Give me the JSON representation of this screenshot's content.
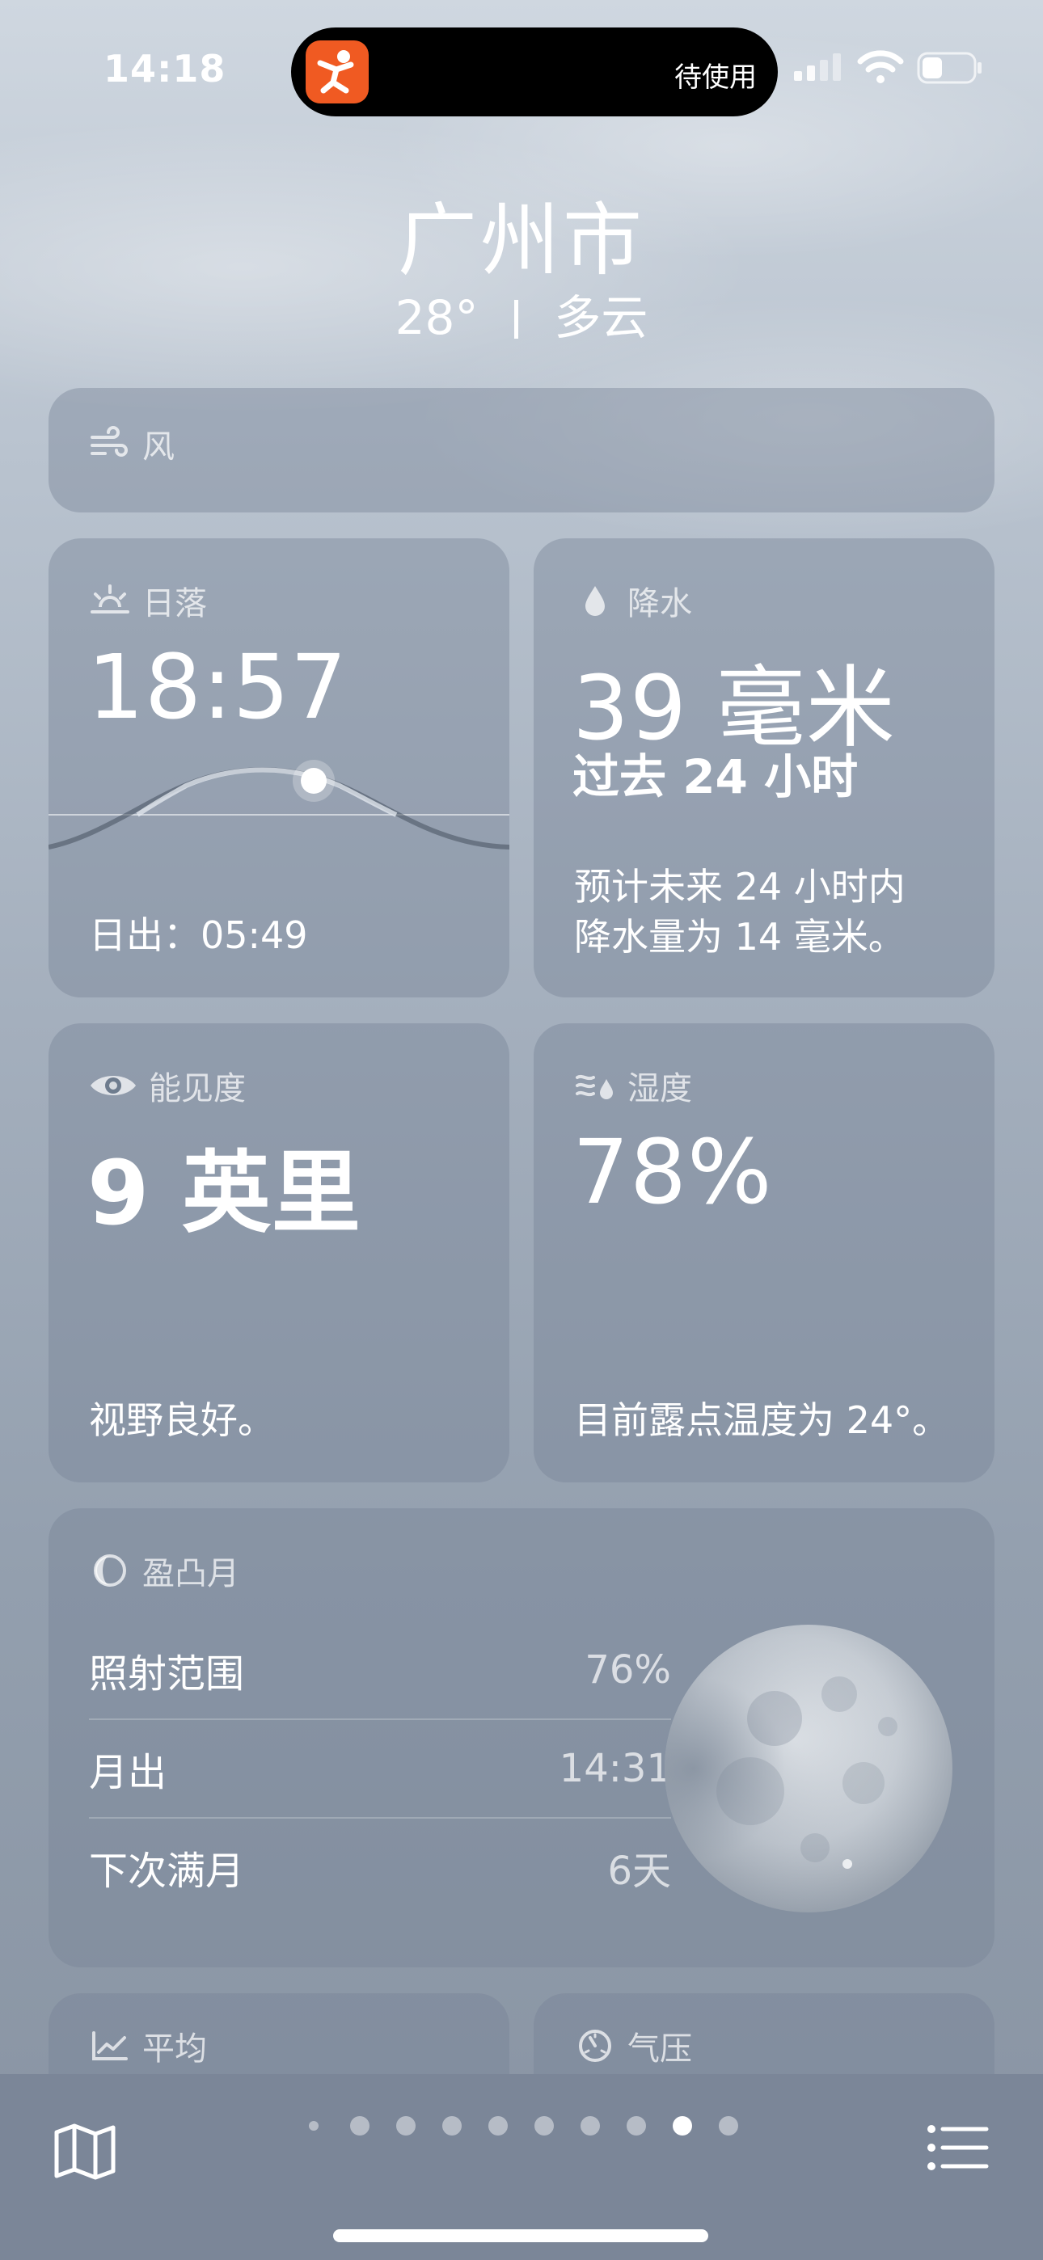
{
  "status_bar": {
    "time": "14:18",
    "island_text": "待使用"
  },
  "header": {
    "city": "广州市",
    "temperature": "28°",
    "condition": "多云"
  },
  "cards": {
    "wind": {
      "title": "风"
    },
    "sunset": {
      "title": "日落",
      "time": "18:57",
      "sunrise_label": "日出：",
      "sunrise_time": "05:49"
    },
    "precipitation": {
      "title": "降水",
      "amount": "39 毫米",
      "period": "过去 24 小时",
      "forecast_line1": "预计未来 24 小时内",
      "forecast_line2": "降水量为 14 毫米。"
    },
    "visibility": {
      "title": "能见度",
      "value": "9 英里",
      "description": "视野良好。"
    },
    "humidity": {
      "title": "湿度",
      "value": "78%",
      "description": "目前露点温度为 24°。"
    },
    "moon": {
      "title": "盈凸月",
      "rows": [
        {
          "label": "照射范围",
          "value": "76%"
        },
        {
          "label": "月出",
          "value": "14:31"
        },
        {
          "label": "下次满月",
          "value": "6天"
        }
      ]
    },
    "average": {
      "title": "平均"
    },
    "pressure": {
      "title": "气压"
    }
  },
  "pagination": {
    "count": 10,
    "current": 8
  },
  "icons": [
    "app-icon",
    "signal-icon",
    "wifi-icon",
    "battery-icon",
    "wind-icon",
    "sunset-icon",
    "raindrop-icon",
    "eye-icon",
    "humidity-icon",
    "moon-phase-icon",
    "trend-icon",
    "gauge-icon",
    "map-icon",
    "list-icon"
  ],
  "colors": {
    "app_icon": "#f05a22",
    "card_bg": "#76849666",
    "bottom_bar": "#7b8698"
  }
}
